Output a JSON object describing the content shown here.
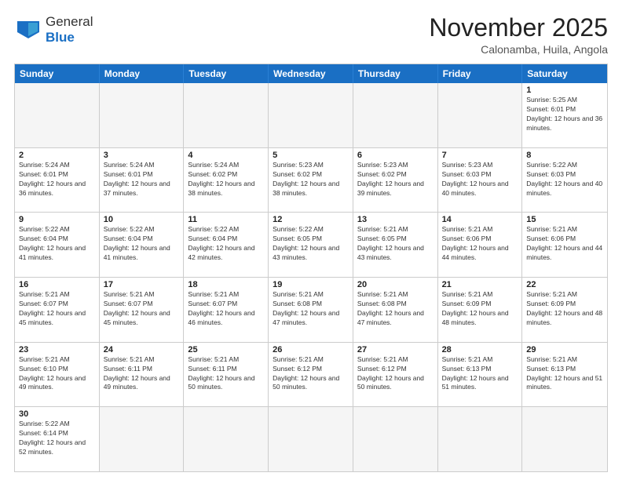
{
  "logo": {
    "line1": "General",
    "line2": "Blue"
  },
  "title": "November 2025",
  "location": "Calonamba, Huila, Angola",
  "days_of_week": [
    "Sunday",
    "Monday",
    "Tuesday",
    "Wednesday",
    "Thursday",
    "Friday",
    "Saturday"
  ],
  "weeks": [
    [
      {
        "day": "",
        "info": ""
      },
      {
        "day": "",
        "info": ""
      },
      {
        "day": "",
        "info": ""
      },
      {
        "day": "",
        "info": ""
      },
      {
        "day": "",
        "info": ""
      },
      {
        "day": "",
        "info": ""
      },
      {
        "day": "1",
        "info": "Sunrise: 5:25 AM\nSunset: 6:01 PM\nDaylight: 12 hours and 36 minutes."
      }
    ],
    [
      {
        "day": "2",
        "info": "Sunrise: 5:24 AM\nSunset: 6:01 PM\nDaylight: 12 hours and 36 minutes."
      },
      {
        "day": "3",
        "info": "Sunrise: 5:24 AM\nSunset: 6:01 PM\nDaylight: 12 hours and 37 minutes."
      },
      {
        "day": "4",
        "info": "Sunrise: 5:24 AM\nSunset: 6:02 PM\nDaylight: 12 hours and 38 minutes."
      },
      {
        "day": "5",
        "info": "Sunrise: 5:23 AM\nSunset: 6:02 PM\nDaylight: 12 hours and 38 minutes."
      },
      {
        "day": "6",
        "info": "Sunrise: 5:23 AM\nSunset: 6:02 PM\nDaylight: 12 hours and 39 minutes."
      },
      {
        "day": "7",
        "info": "Sunrise: 5:23 AM\nSunset: 6:03 PM\nDaylight: 12 hours and 40 minutes."
      },
      {
        "day": "8",
        "info": "Sunrise: 5:22 AM\nSunset: 6:03 PM\nDaylight: 12 hours and 40 minutes."
      }
    ],
    [
      {
        "day": "9",
        "info": "Sunrise: 5:22 AM\nSunset: 6:04 PM\nDaylight: 12 hours and 41 minutes."
      },
      {
        "day": "10",
        "info": "Sunrise: 5:22 AM\nSunset: 6:04 PM\nDaylight: 12 hours and 41 minutes."
      },
      {
        "day": "11",
        "info": "Sunrise: 5:22 AM\nSunset: 6:04 PM\nDaylight: 12 hours and 42 minutes."
      },
      {
        "day": "12",
        "info": "Sunrise: 5:22 AM\nSunset: 6:05 PM\nDaylight: 12 hours and 43 minutes."
      },
      {
        "day": "13",
        "info": "Sunrise: 5:21 AM\nSunset: 6:05 PM\nDaylight: 12 hours and 43 minutes."
      },
      {
        "day": "14",
        "info": "Sunrise: 5:21 AM\nSunset: 6:06 PM\nDaylight: 12 hours and 44 minutes."
      },
      {
        "day": "15",
        "info": "Sunrise: 5:21 AM\nSunset: 6:06 PM\nDaylight: 12 hours and 44 minutes."
      }
    ],
    [
      {
        "day": "16",
        "info": "Sunrise: 5:21 AM\nSunset: 6:07 PM\nDaylight: 12 hours and 45 minutes."
      },
      {
        "day": "17",
        "info": "Sunrise: 5:21 AM\nSunset: 6:07 PM\nDaylight: 12 hours and 45 minutes."
      },
      {
        "day": "18",
        "info": "Sunrise: 5:21 AM\nSunset: 6:07 PM\nDaylight: 12 hours and 46 minutes."
      },
      {
        "day": "19",
        "info": "Sunrise: 5:21 AM\nSunset: 6:08 PM\nDaylight: 12 hours and 47 minutes."
      },
      {
        "day": "20",
        "info": "Sunrise: 5:21 AM\nSunset: 6:08 PM\nDaylight: 12 hours and 47 minutes."
      },
      {
        "day": "21",
        "info": "Sunrise: 5:21 AM\nSunset: 6:09 PM\nDaylight: 12 hours and 48 minutes."
      },
      {
        "day": "22",
        "info": "Sunrise: 5:21 AM\nSunset: 6:09 PM\nDaylight: 12 hours and 48 minutes."
      }
    ],
    [
      {
        "day": "23",
        "info": "Sunrise: 5:21 AM\nSunset: 6:10 PM\nDaylight: 12 hours and 49 minutes."
      },
      {
        "day": "24",
        "info": "Sunrise: 5:21 AM\nSunset: 6:11 PM\nDaylight: 12 hours and 49 minutes."
      },
      {
        "day": "25",
        "info": "Sunrise: 5:21 AM\nSunset: 6:11 PM\nDaylight: 12 hours and 50 minutes."
      },
      {
        "day": "26",
        "info": "Sunrise: 5:21 AM\nSunset: 6:12 PM\nDaylight: 12 hours and 50 minutes."
      },
      {
        "day": "27",
        "info": "Sunrise: 5:21 AM\nSunset: 6:12 PM\nDaylight: 12 hours and 50 minutes."
      },
      {
        "day": "28",
        "info": "Sunrise: 5:21 AM\nSunset: 6:13 PM\nDaylight: 12 hours and 51 minutes."
      },
      {
        "day": "29",
        "info": "Sunrise: 5:21 AM\nSunset: 6:13 PM\nDaylight: 12 hours and 51 minutes."
      }
    ],
    [
      {
        "day": "30",
        "info": "Sunrise: 5:22 AM\nSunset: 6:14 PM\nDaylight: 12 hours and 52 minutes."
      },
      {
        "day": "",
        "info": ""
      },
      {
        "day": "",
        "info": ""
      },
      {
        "day": "",
        "info": ""
      },
      {
        "day": "",
        "info": ""
      },
      {
        "day": "",
        "info": ""
      },
      {
        "day": "",
        "info": ""
      }
    ]
  ]
}
